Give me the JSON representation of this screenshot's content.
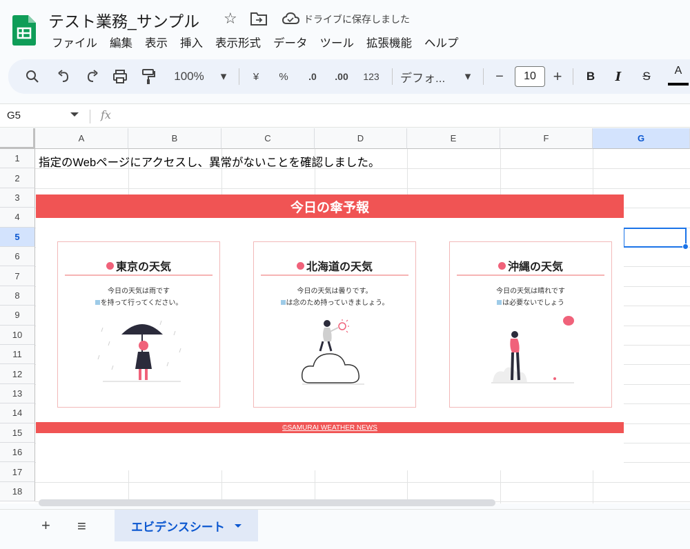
{
  "header": {
    "title": "テスト業務_サンプル",
    "save_status": "ドライブに保存しました",
    "menu": [
      "ファイル",
      "編集",
      "表示",
      "挿入",
      "表示形式",
      "データ",
      "ツール",
      "拡張機能",
      "ヘルプ"
    ]
  },
  "toolbar": {
    "zoom": "100%",
    "currency": "¥",
    "percent": "%",
    "decrease_decimal": ".0",
    "increase_decimal": ".00",
    "number_format": "123",
    "font": "デフォ...",
    "font_size": "10",
    "minus": "−",
    "plus": "+",
    "bold": "B",
    "italic": "I",
    "strike": "S",
    "text_color": "A"
  },
  "formula_bar": {
    "name_box": "G5",
    "fx": "fx"
  },
  "grid": {
    "columns": [
      "A",
      "B",
      "C",
      "D",
      "E",
      "F",
      "G"
    ],
    "rows": [
      "1",
      "2",
      "3",
      "4",
      "5",
      "6",
      "7",
      "8",
      "9",
      "10",
      "11",
      "12",
      "13",
      "14",
      "15",
      "16",
      "17",
      "18"
    ],
    "selected_column": "G",
    "selected_row": "5",
    "cell_a1": "指定のWebページにアクセスし、異常がないことを確認しました。"
  },
  "embed": {
    "banner": "今日の傘予報",
    "cards": [
      {
        "title": "東京の天気",
        "line1": "今日の天気は雨です",
        "line2": "を持って行ってください。"
      },
      {
        "title": "北海道の天気",
        "line1": "今日の天気は曇りです。",
        "line2": "は念のため持っていきましょう。"
      },
      {
        "title": "沖縄の天気",
        "line1": "今日の天気は晴れです",
        "line2": "は必要ないでしょう"
      }
    ],
    "footer": "©SAMURAI WEATHER NEWS"
  },
  "tabs": {
    "add": "+",
    "all": "≡",
    "active_sheet": "エビデンスシート"
  },
  "colors": {
    "brand_green": "#0f9d58",
    "accent_red": "#f05454",
    "selection_blue": "#1a73e8"
  }
}
